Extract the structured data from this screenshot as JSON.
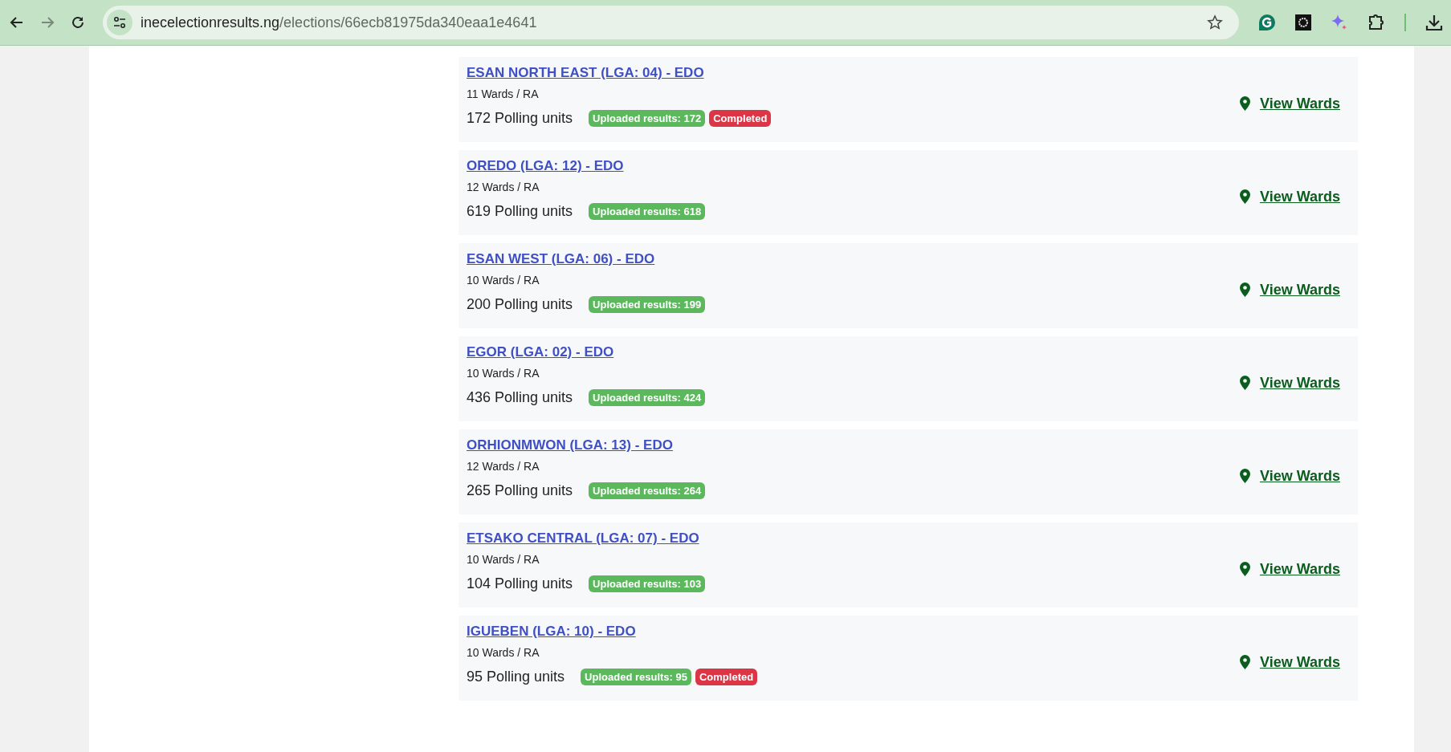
{
  "browser": {
    "url": {
      "host": "inecelectionresults.ng",
      "path": "/elections/66ecb81975da340eaa1e4641"
    }
  },
  "lgas": [
    {
      "title": "ESAN NORTH EAST (LGA: 04) - EDO",
      "wards": "11 Wards / RA",
      "polling_units": "172 Polling units",
      "badges": [
        {
          "kind": "uploaded",
          "text": "Uploaded results: 172"
        },
        {
          "kind": "completed",
          "text": "Completed"
        }
      ],
      "link": "View Wards"
    },
    {
      "title": "OREDO (LGA: 12) - EDO",
      "wards": "12 Wards / RA",
      "polling_units": "619 Polling units",
      "badges": [
        {
          "kind": "uploaded",
          "text": "Uploaded results: 618"
        }
      ],
      "link": "View Wards"
    },
    {
      "title": "ESAN WEST (LGA: 06) - EDO",
      "wards": "10 Wards / RA",
      "polling_units": "200 Polling units",
      "badges": [
        {
          "kind": "uploaded",
          "text": "Uploaded results: 199"
        }
      ],
      "link": "View Wards"
    },
    {
      "title": "EGOR (LGA: 02) - EDO",
      "wards": "10 Wards / RA",
      "polling_units": "436 Polling units",
      "badges": [
        {
          "kind": "uploaded",
          "text": "Uploaded results: 424"
        }
      ],
      "link": "View Wards"
    },
    {
      "title": "ORHIONMWON (LGA: 13) - EDO",
      "wards": "12 Wards / RA",
      "polling_units": "265 Polling units",
      "badges": [
        {
          "kind": "uploaded",
          "text": "Uploaded results: 264"
        }
      ],
      "link": "View Wards"
    },
    {
      "title": "ETSAKO CENTRAL (LGA: 07) - EDO",
      "wards": "10 Wards / RA",
      "polling_units": "104 Polling units",
      "badges": [
        {
          "kind": "uploaded",
          "text": "Uploaded results: 103"
        }
      ],
      "link": "View Wards"
    },
    {
      "title": "IGUEBEN (LGA: 10) - EDO",
      "wards": "10 Wards / RA",
      "polling_units": "95 Polling units",
      "badges": [
        {
          "kind": "uploaded",
          "text": "Uploaded results: 95"
        },
        {
          "kind": "completed",
          "text": "Completed"
        }
      ],
      "link": "View Wards"
    }
  ]
}
